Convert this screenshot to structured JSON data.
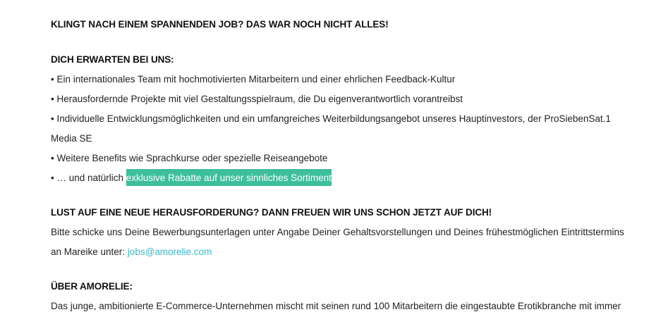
{
  "sections": {
    "intro_heading": "KLINGT NACH EINEM SPANNENDEN JOB? DAS WAR NOCH NICHT ALLES!",
    "benefits_heading": "DICH ERWARTEN BEI UNS:",
    "benefits": [
      "• Ein internationales Team mit hochmotivierten Mitarbeitern und einer ehrlichen Feedback-Kultur",
      "• Herausfordernde Projekte mit viel Gestaltungsspielraum, die Du eigenverantwortlich vorantreibst",
      "• Individuelle Entwicklungsmöglichkeiten und ein umfangreiches Weiterbildungsangebot unseres Hauptinvestors, der ProSiebenSat.1",
      "Media SE",
      "• Weitere Benefits wie Sprachkurse oder spezielle Reiseangebote"
    ],
    "last_benefit_prefix": "• … und natürlich ",
    "last_benefit_highlight": "exklusive Rabatte auf unser sinnliches Sortiment",
    "apply_heading": "LUST AUF EINE NEUE HERAUSFORDERUNG? DANN FREUEN WIR UNS SCHON JETZT AUF DICH!",
    "apply_text_1": "Bitte schicke uns Deine Bewerbungsunterlagen unter Angabe Deiner Gehaltsvorstellungen und Deines frühestmöglichen Eintrittstermins",
    "apply_text_2_prefix": "an Mareike unter: ",
    "apply_email": "jobs@amorelie.com",
    "about_heading": "ÜBER AMORELIE:",
    "about_text": "Das junge, ambitionierte E-Commerce-Unternehmen mischt mit seinen rund 100 Mitarbeitern die eingestaubte Erotikbranche mit immer"
  },
  "colors": {
    "highlight_background": "#3dbe9c",
    "link": "#39b8c4",
    "text": "#222222"
  }
}
